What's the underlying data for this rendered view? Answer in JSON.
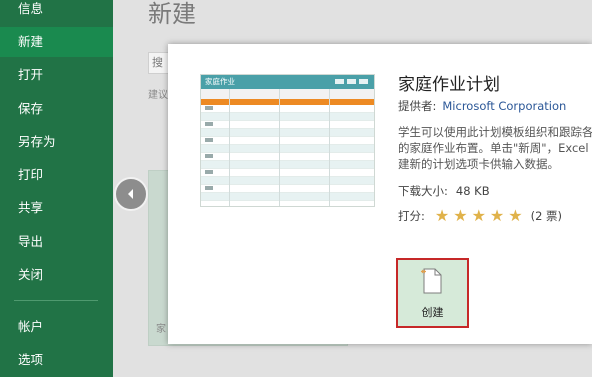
{
  "nav": {
    "items": [
      {
        "label": "信息",
        "active": false
      },
      {
        "label": "新建",
        "active": true
      },
      {
        "label": "打开",
        "active": false
      },
      {
        "label": "保存",
        "active": false
      },
      {
        "label": "另存为",
        "active": false
      },
      {
        "label": "打印",
        "active": false
      },
      {
        "label": "共享",
        "active": false
      },
      {
        "label": "导出",
        "active": false
      },
      {
        "label": "关闭",
        "active": false
      },
      {
        "label": "帐户",
        "active": false
      },
      {
        "label": "选项",
        "active": false
      }
    ]
  },
  "backdrop": {
    "title": "新建",
    "search_fragment": "搜",
    "suggest_fragment": "建议",
    "thumb_label_fragment": "家"
  },
  "modal": {
    "preview": {
      "header_text": "家庭作业"
    },
    "title": "家庭作业计划",
    "provider_label": "提供者:",
    "provider_value": "Microsoft Corporation",
    "description_lines": [
      "学生可以使用此计划模板组织和跟踪各科",
      "的家庭作业布置。单击\"新周\"，Excel 将",
      "建新的计划选项卡供输入数据。"
    ],
    "size_label": "下载大小:",
    "size_value": "48 KB",
    "rating_label": "打分:",
    "rating_value": 5,
    "rating_max": 5,
    "votes": "(2 票)",
    "create_label": "创建"
  },
  "colors": {
    "nav_bg": "#217346",
    "accent_orange": "#ed8a23",
    "preview_teal": "#4aa0a8",
    "star": "#e0b24a",
    "create_bg": "#d6ead9",
    "highlight_border": "#c62828"
  },
  "icons": {
    "prev": "chevron-left-icon",
    "create": "new-document-icon",
    "star": "star-icon"
  }
}
